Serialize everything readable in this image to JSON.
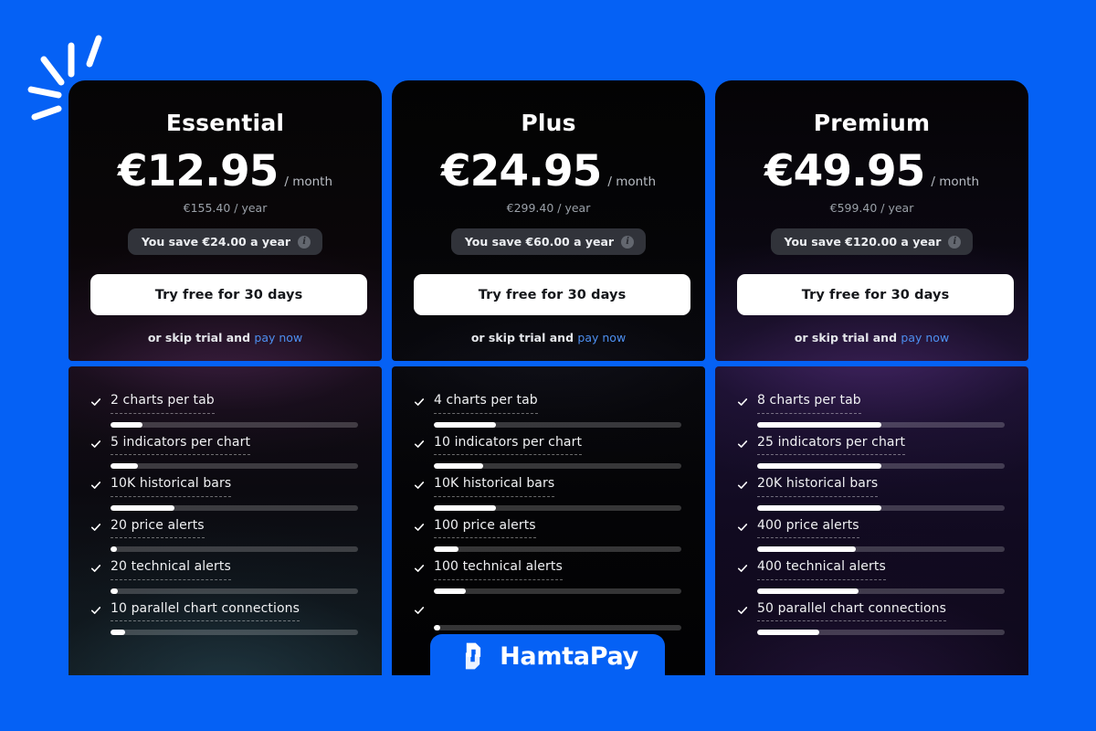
{
  "background_color": "#0561F5",
  "accent_link_color": "#4d8ff0",
  "decoration": {
    "sparkle_name": "sparkle-burst-decoration"
  },
  "plans": [
    {
      "name": "Essential",
      "price": "€12.95",
      "period": "/ month",
      "yearly": "€155.40 / year",
      "save_text": "You save €24.00 a year",
      "info_glyph": "i",
      "cta_label": "Try free for 30 days",
      "skip_prefix": "or skip trial and",
      "skip_link": "pay now",
      "features": [
        {
          "label": "2 charts per tab",
          "fill_pct": 13
        },
        {
          "label": "5 indicators per chart",
          "fill_pct": 11
        },
        {
          "label": "10K historical bars",
          "fill_pct": 26
        },
        {
          "label": "20 price alerts",
          "fill_pct": 2
        },
        {
          "label": "20 technical alerts",
          "fill_pct": 3
        },
        {
          "label": "10 parallel chart connections",
          "fill_pct": 6
        }
      ]
    },
    {
      "name": "Plus",
      "price": "€24.95",
      "period": "/ month",
      "yearly": "€299.40 / year",
      "save_text": "You save €60.00 a year",
      "info_glyph": "i",
      "cta_label": "Try free for 30 days",
      "skip_prefix": "or skip trial and",
      "skip_link": "pay now",
      "features": [
        {
          "label": "4 charts per tab",
          "fill_pct": 25
        },
        {
          "label": "10 indicators per chart",
          "fill_pct": 20
        },
        {
          "label": "10K historical bars",
          "fill_pct": 25
        },
        {
          "label": "100 price alerts",
          "fill_pct": 10
        },
        {
          "label": "100 technical alerts",
          "fill_pct": 13
        },
        {
          "label": "",
          "fill_pct": 0
        }
      ]
    },
    {
      "name": "Premium",
      "price": "€49.95",
      "period": "/ month",
      "yearly": "€599.40 / year",
      "save_text": "You save €120.00 a year",
      "info_glyph": "i",
      "cta_label": "Try free for 30 days",
      "skip_prefix": "or skip trial and",
      "skip_link": "pay now",
      "features": [
        {
          "label": "8 charts per tab",
          "fill_pct": 50
        },
        {
          "label": "25 indicators per chart",
          "fill_pct": 50
        },
        {
          "label": "20K historical bars",
          "fill_pct": 50
        },
        {
          "label": "400 price alerts",
          "fill_pct": 40
        },
        {
          "label": "400 technical alerts",
          "fill_pct": 41
        },
        {
          "label": "50 parallel chart connections",
          "fill_pct": 25
        }
      ]
    }
  ],
  "watermark": {
    "brand": "HamtaPay",
    "logo_name": "hamta-pay-logo"
  }
}
